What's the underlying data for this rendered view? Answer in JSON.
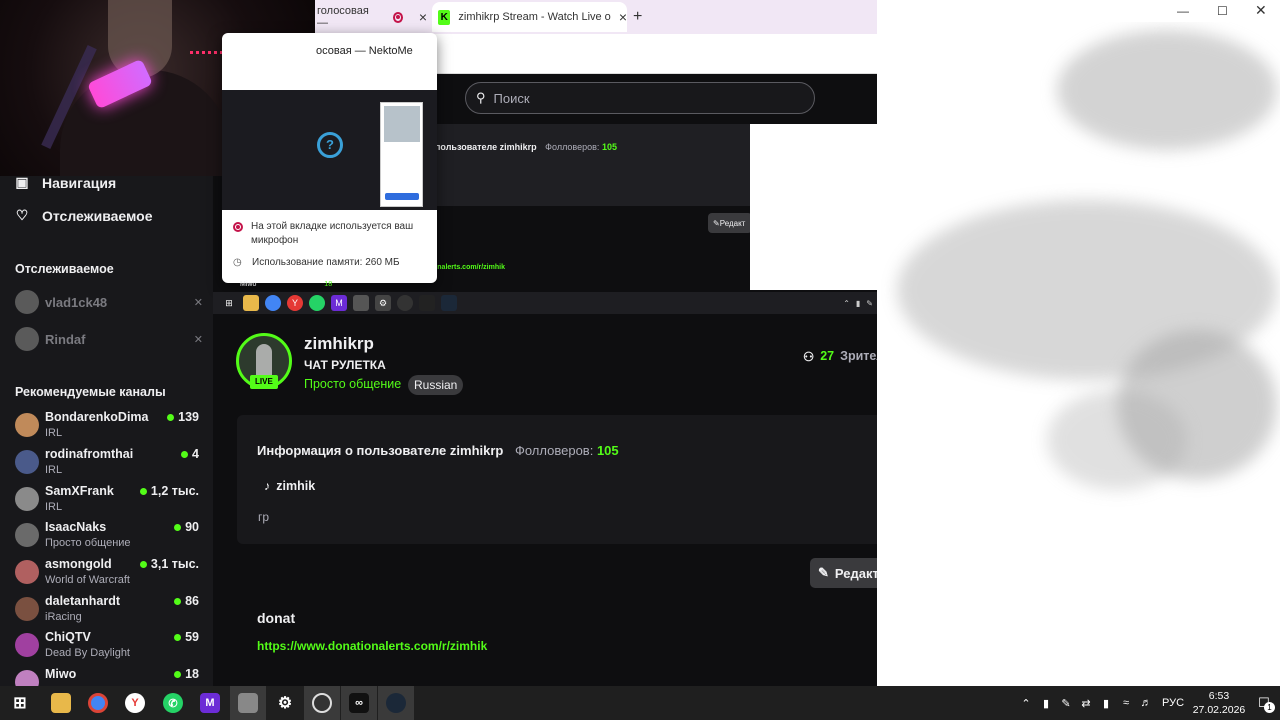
{
  "inner_browser": {
    "tab1_label": "голосовая — ",
    "tab2_label": "zimhikrp Stream - Watch Live o",
    "close_icon": "×",
    "new_tab_icon": "+",
    "search_placeholder": "Поиск",
    "info_title": "пользователе zimhikrp",
    "followers_label": "Фолловеров:",
    "followers_value": "105",
    "edit_label": "Редакт",
    "donation_link": "onalerts.com/r/zimhik"
  },
  "popup": {
    "title": "осовая — NektoMe",
    "mic_text": "На этой вкладке используется ваш микрофон",
    "memory_text": "Использование памяти: 260 МБ",
    "mini_name": "Miwo",
    "mini_count": "18"
  },
  "sidebar": {
    "nav": [
      {
        "icon": "browse-icon",
        "label": "Навигация"
      },
      {
        "icon": "heart-icon",
        "label": "Отслеживаемое"
      }
    ],
    "followed_heading": "Отслеживаемое",
    "followed": [
      {
        "name": "vlad1ck48"
      },
      {
        "name": "Rindaf"
      }
    ],
    "recommended_heading": "Рекомендуемые каналы",
    "recommended": [
      {
        "name": "BondarenkoDima",
        "category": "IRL",
        "viewers": "139",
        "color": "#c08a5a"
      },
      {
        "name": "rodinafromthai",
        "category": "IRL",
        "viewers": "4",
        "color": "#4a5a8a"
      },
      {
        "name": "SamXFrank",
        "category": "IRL",
        "viewers": "1,2 тыс.",
        "color": "#8a8a8a"
      },
      {
        "name": "IsaacNaks",
        "category": "Просто общение",
        "viewers": "90",
        "color": "#6a6a6a"
      },
      {
        "name": "asmongold",
        "category": "World of Warcraft",
        "viewers": "3,1 тыс.",
        "color": "#b06060"
      },
      {
        "name": "daletanhardt",
        "category": "iRacing",
        "viewers": "86",
        "color": "#7a5040"
      },
      {
        "name": "ChiQTV",
        "category": "Dead By Daylight",
        "viewers": "59",
        "color": "#a040a0"
      },
      {
        "name": "Miwo",
        "category": "",
        "viewers": "18",
        "color": "#c080c0"
      }
    ]
  },
  "channel": {
    "name": "zimhikrp",
    "live_badge": "LIVE",
    "stream_title": "ЧАТ РУЛЕТКА",
    "category": "Просто общение",
    "tag": "Russian",
    "viewers_count": "27",
    "viewers_label": "Зрител"
  },
  "about": {
    "title": "Информация о пользователе zimhikrp",
    "followers_label": "Фолловеров:",
    "followers_value": "105",
    "tiktok_handle": "zimhik",
    "bio": "гр"
  },
  "panel": {
    "edit_label": "Редакт",
    "donat_title": "donat",
    "donat_link": "https://www.donationalerts.com/r/zimhik"
  },
  "taskbar": {
    "language": "РУС",
    "time": "6:53",
    "date": "27.02.2026",
    "notification_count": "1"
  }
}
